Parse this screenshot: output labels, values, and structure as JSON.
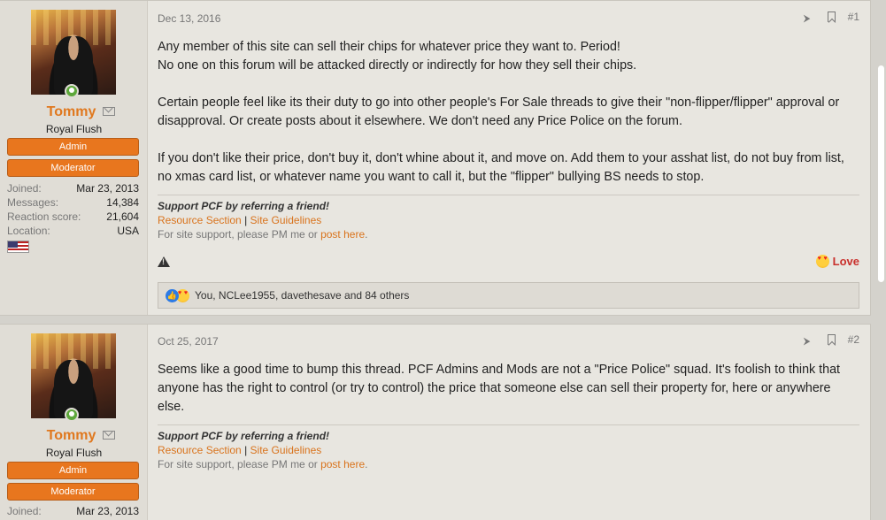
{
  "posts": [
    {
      "user": {
        "name": "Tommy",
        "title": "Royal Flush",
        "banners": [
          "Admin",
          "Moderator"
        ],
        "stats": [
          {
            "label": "Joined:",
            "value": "Mar 23, 2013"
          },
          {
            "label": "Messages:",
            "value": "14,384"
          },
          {
            "label": "Reaction score:",
            "value": "21,604"
          },
          {
            "label": "Location:",
            "value": "USA"
          }
        ]
      },
      "date": "Dec 13, 2016",
      "number": "#1",
      "paragraphs": [
        "Any member of this site can sell their chips for whatever price they want to. Period!\nNo one on this forum will be attacked directly or indirectly for how they sell their chips.",
        "Certain people feel like its their duty to go into other people's For Sale threads to give their \"non-flipper/flipper\" approval or disapproval. Or create posts about it elsewhere. We don't need any Price Police on the forum.",
        "If you don't like their price, don't buy it, don't whine about it, and move on. Add them to your asshat list, do not buy from list, no xmas card list, or whatever name you want to call it, but the \"flipper\" bullying BS needs to stop."
      ],
      "signature": {
        "line1": "Support PCF by referring a friend!",
        "link1": "Resource Section",
        "separator": "|",
        "link2": "Site Guidelines",
        "line3_prefix": "For site support, please PM me or ",
        "line3_link": "post here",
        "line3_suffix": "."
      },
      "reaction_button": "Love",
      "reactions_summary": "You, NCLee1955, davethesave and 84 others"
    },
    {
      "user": {
        "name": "Tommy",
        "title": "Royal Flush",
        "banners": [
          "Admin",
          "Moderator"
        ],
        "stats": [
          {
            "label": "Joined:",
            "value": "Mar 23, 2013"
          }
        ]
      },
      "date": "Oct 25, 2017",
      "number": "#2",
      "paragraphs": [
        "Seems like a good time to bump this thread. PCF Admins and Mods are not a \"Price Police\" squad. It's foolish to think that anyone has the right to control (or try to control) the price that someone else can sell their property for, here or anywhere else."
      ],
      "signature": {
        "line1": "Support PCF by referring a friend!",
        "link1": "Resource Section",
        "separator": "|",
        "link2": "Site Guidelines",
        "line3_prefix": "For site support, please PM me or ",
        "line3_link": "post here",
        "line3_suffix": "."
      }
    }
  ]
}
